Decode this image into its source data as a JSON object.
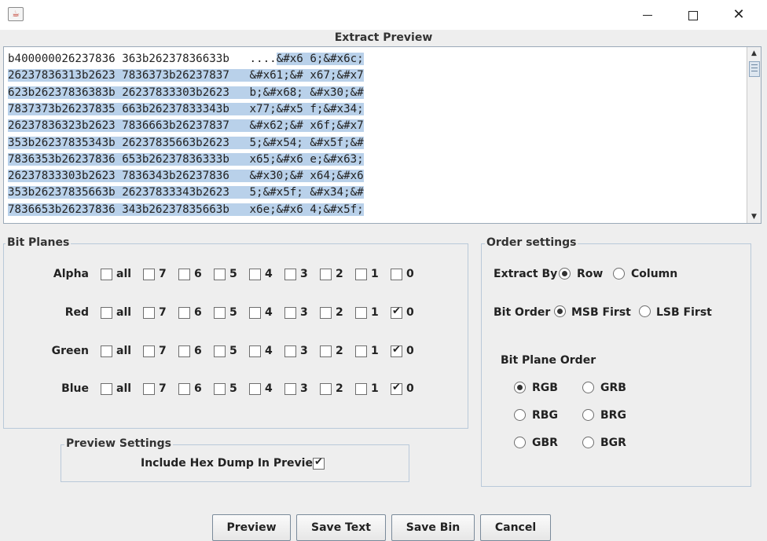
{
  "window": {
    "app_icon": "java-icon",
    "title": "Extract Preview"
  },
  "preview": {
    "rows": [
      {
        "hex": "b400000026237836 363b26237836633b",
        "ascii_plain": " ....",
        "ascii_sel": "&#x6 6;&#x6c;"
      },
      {
        "hex": "26237836313b2623 7836373b26237837",
        "ascii_plain": " ",
        "ascii_sel": "&#x61;&# x67;&#x7"
      },
      {
        "hex": "623b26237836383b 26237833303b2623",
        "ascii_plain": " ",
        "ascii_sel": "b;&#x68; &#x30;&#"
      },
      {
        "hex": "7837373b26237835 663b26237833343b",
        "ascii_plain": " ",
        "ascii_sel": "x77;&#x5 f;&#x34;"
      },
      {
        "hex": "26237836323b2623 7836663b26237837",
        "ascii_plain": " ",
        "ascii_sel": "&#x62;&# x6f;&#x7"
      },
      {
        "hex": "353b26237835343b 26237835663b2623",
        "ascii_plain": " ",
        "ascii_sel": "5;&#x54; &#x5f;&#"
      },
      {
        "hex": "7836353b26237836 653b26237836333b",
        "ascii_plain": " ",
        "ascii_sel": "x65;&#x6 e;&#x63;"
      },
      {
        "hex": "26237833303b2623 7836343b26237836",
        "ascii_plain": " ",
        "ascii_sel": "&#x30;&# x64;&#x6"
      },
      {
        "hex": "353b26237835663b 26237833343b2623",
        "ascii_plain": " ",
        "ascii_sel": "5;&#x5f; &#x34;&#"
      },
      {
        "hex": "7836653b26237836 343b26237835663b",
        "ascii_plain": " ",
        "ascii_sel": "x6e;&#x6 4;&#x5f;"
      }
    ],
    "selection_color": "#b9d1ea"
  },
  "bit_planes": {
    "title": "Bit Planes",
    "bits": [
      "all",
      "7",
      "6",
      "5",
      "4",
      "3",
      "2",
      "1",
      "0"
    ],
    "channels": [
      {
        "label": "Alpha",
        "checked": [
          false,
          false,
          false,
          false,
          false,
          false,
          false,
          false,
          false
        ]
      },
      {
        "label": "Red",
        "checked": [
          false,
          false,
          false,
          false,
          false,
          false,
          false,
          false,
          true
        ]
      },
      {
        "label": "Green",
        "checked": [
          false,
          false,
          false,
          false,
          false,
          false,
          false,
          false,
          true
        ]
      },
      {
        "label": "Blue",
        "checked": [
          false,
          false,
          false,
          false,
          false,
          false,
          false,
          false,
          true
        ]
      }
    ]
  },
  "preview_settings": {
    "title": "Preview Settings",
    "include_hex_label": "Include Hex Dump In Preview",
    "include_hex_checked": true
  },
  "order_settings": {
    "title": "Order settings",
    "extract_by_label": "Extract By",
    "extract_by_options": [
      "Row",
      "Column"
    ],
    "extract_by_selected": "Row",
    "bit_order_label": "Bit Order",
    "bit_order_options": [
      "MSB First",
      "LSB First"
    ],
    "bit_order_selected": "MSB First",
    "bit_plane_order_label": "Bit Plane Order",
    "bit_plane_order_options": [
      "RGB",
      "GRB",
      "RBG",
      "BRG",
      "GBR",
      "BGR"
    ],
    "bit_plane_order_selected": "RGB"
  },
  "buttons": {
    "preview": "Preview",
    "save_text": "Save Text",
    "save_bin": "Save Bin",
    "cancel": "Cancel"
  }
}
